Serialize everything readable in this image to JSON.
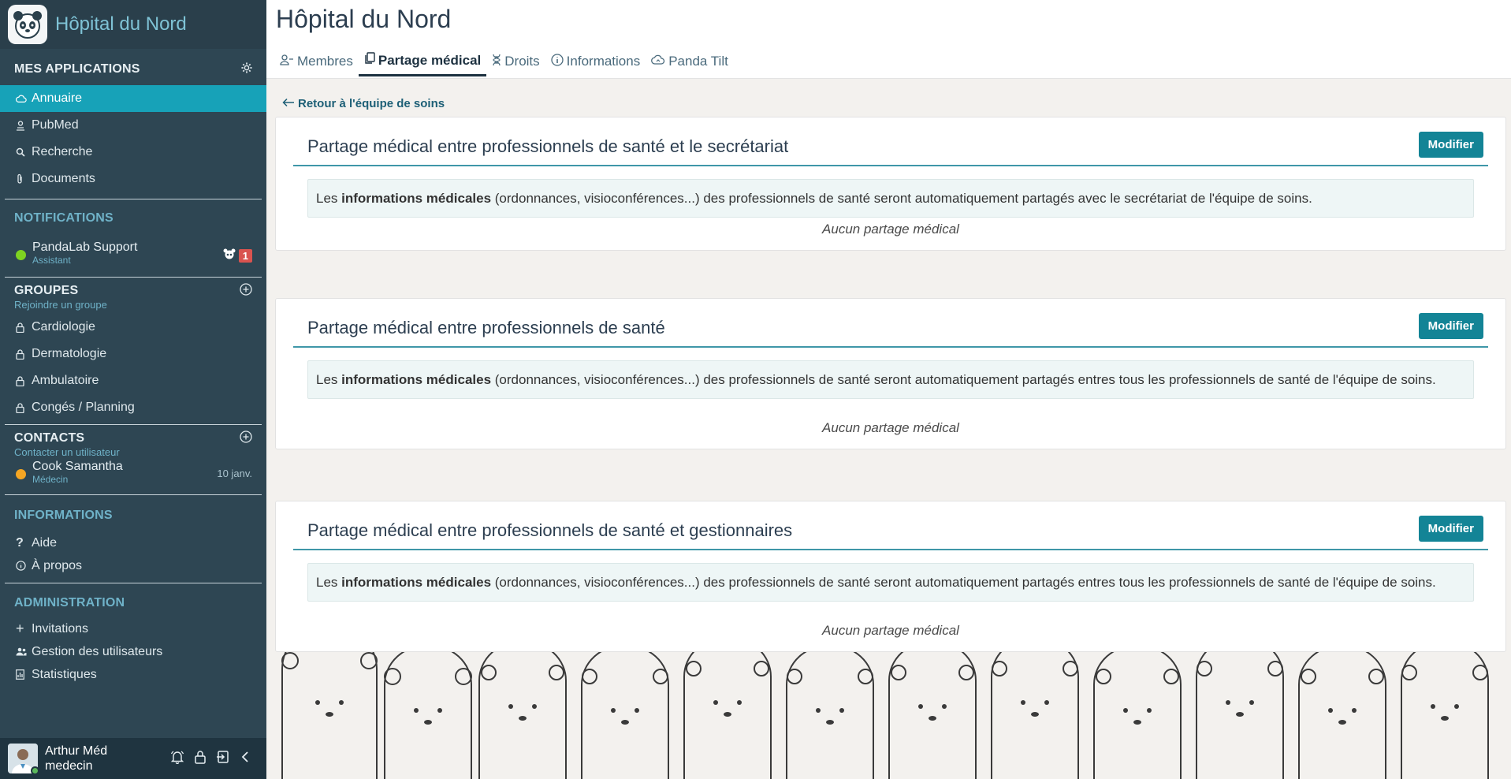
{
  "brand": {
    "title": "Hôpital du Nord",
    "logo_icon": "panda-icon"
  },
  "sidebar": {
    "apps_title": "MES APPLICATIONS",
    "apps": [
      {
        "label": "Annuaire",
        "icon": "cloud-icon",
        "active": true
      },
      {
        "label": "PubMed",
        "icon": "person-book-icon"
      },
      {
        "label": "Recherche",
        "icon": "search-icon"
      },
      {
        "label": "Documents",
        "icon": "paperclip-icon"
      }
    ],
    "notifications_title": "NOTIFICATIONS",
    "notification": {
      "name": "PandaLab Support",
      "sub": "Assistant",
      "badge": "1",
      "status_color": "#7ed321"
    },
    "groups_title": "GROUPES",
    "groups_sub": "Rejoindre un groupe",
    "groups": [
      "Cardiologie",
      "Dermatologie",
      "Ambulatoire",
      "Congés / Planning"
    ],
    "contacts_title": "CONTACTS",
    "contacts_sub": "Contacter un utilisateur",
    "contact": {
      "name": "Cook Samantha",
      "sub": "Médecin",
      "date": "10 janv.",
      "status_color": "#f5a623"
    },
    "info_title": "INFORMATIONS",
    "info_items": [
      {
        "label": "Aide",
        "icon": "question-icon"
      },
      {
        "label": "À propos",
        "icon": "info-icon"
      }
    ],
    "admin_title": "ADMINISTRATION",
    "admin_items": [
      {
        "label": "Invitations",
        "icon": "plus-icon"
      },
      {
        "label": "Gestion des utilisateurs",
        "icon": "users-icon"
      },
      {
        "label": "Statistiques",
        "icon": "chart-icon"
      }
    ],
    "user": {
      "name": "Arthur Méd",
      "role": "medecin"
    }
  },
  "header": {
    "title": "Hôpital du Nord",
    "tabs": [
      {
        "label": "Membres",
        "icon": "user-icon"
      },
      {
        "label": "Partage médical",
        "icon": "copy-icon",
        "active": true
      },
      {
        "label": "Droits",
        "icon": "dna-icon"
      },
      {
        "label": "Informations",
        "icon": "info-icon"
      },
      {
        "label": "Panda Tilt",
        "icon": "cloud-icon"
      }
    ]
  },
  "main": {
    "back_label": "Retour à l'équipe de soins",
    "modify_label": "Modifier",
    "empty_label": "Aucun partage médical",
    "cards": [
      {
        "title": "Partage médical entre professionnels de santé et le secrétariat",
        "pre": "Les ",
        "bold": "informations médicales",
        "post": " (ordonnances, visioconférences...) des professionnels de santé seront automatiquement partagés avec le secrétariat de l'équipe de soins."
      },
      {
        "title": "Partage médical entre professionnels de santé",
        "pre": "Les ",
        "bold": "informations médicales",
        "post": " (ordonnances, visioconférences...) des professionnels de santé seront automatiquement partagés entres tous les professionnels de santé de l'équipe de soins."
      },
      {
        "title": "Partage médical entre professionnels de santé et gestionnaires",
        "pre": "Les ",
        "bold": "informations médicales",
        "post": " (ordonnances, visioconférences...) des professionnels de santé seront automatiquement partagés entres tous les professionnels de santé de l'équipe de soins."
      }
    ]
  }
}
